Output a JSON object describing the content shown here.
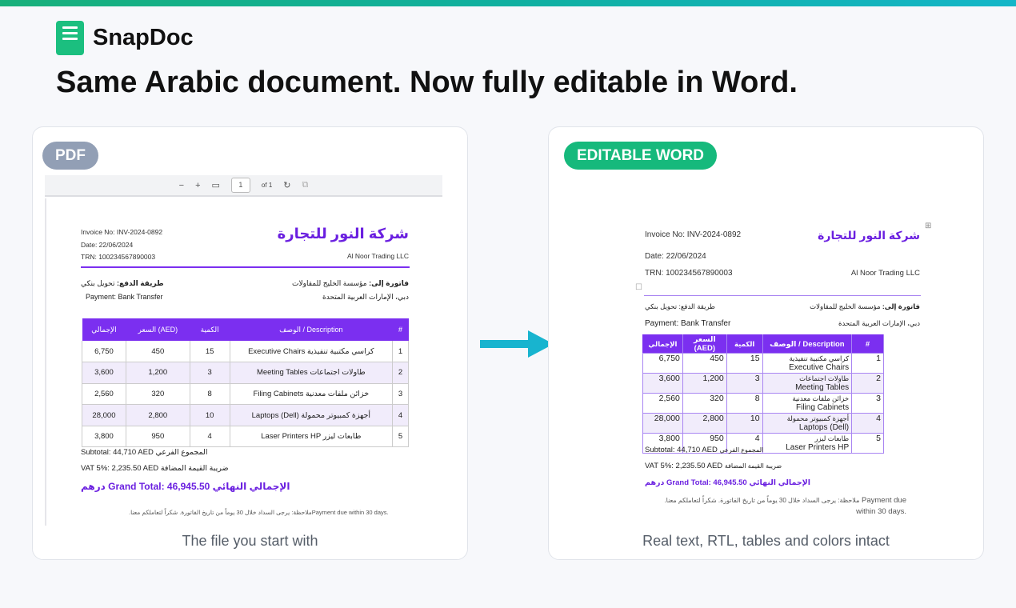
{
  "brand": {
    "name": "SnapDoc"
  },
  "headline": "Same Arabic document. Now fully editable in Word.",
  "left_card": {
    "badge": "PDF",
    "caption": "The file you start with",
    "toolbar": {
      "zoom_out": "−",
      "zoom_in": "+",
      "page_value": "1",
      "page_of": "of 1"
    }
  },
  "right_card": {
    "badge": "EDITABLE WORD",
    "caption": "Real text, RTL, tables and colors intact"
  },
  "colors": {
    "accent_green": "#16b97c",
    "accent_purple": "#7b2ff0",
    "pdf_badge": "#929fb5",
    "arrow": "#18b4cf"
  },
  "invoice": {
    "invoice_no": "Invoice No: INV-2024-0892",
    "date": "Date: 22/06/2024",
    "trn": "TRN: 100234567890003",
    "company_ar": "شركة النور للتجارة",
    "company_en": "Al Noor Trading LLC",
    "bill_to_label": "فاتورة إلى:",
    "bill_to_name": "مؤسسة الخليج للمقاولات",
    "bill_to_city": "دبي، الإمارات العربية المتحدة",
    "payment_label_ar": "طريقة الدفع:",
    "payment_value_ar": "تحويل بنكي",
    "payment_en": "Payment: Bank Transfer",
    "headers": {
      "num": "#",
      "desc": "الوصف / Description",
      "qty": "الكمية",
      "price": "السعر (AED)",
      "total": "الإجمالي"
    },
    "rows": [
      {
        "num": "1",
        "desc_ar": "كراسي مكتبية تنفيذية",
        "desc_en": "Executive Chairs",
        "qty": "15",
        "price": "450",
        "total": "6,750"
      },
      {
        "num": "2",
        "desc_ar": "طاولات اجتماعات",
        "desc_en": "Meeting Tables",
        "qty": "3",
        "price": "1,200",
        "total": "3,600"
      },
      {
        "num": "3",
        "desc_ar": "خزائن ملفات معدنية",
        "desc_en": "Filing Cabinets",
        "qty": "8",
        "price": "320",
        "total": "2,560"
      },
      {
        "num": "4",
        "desc_ar": "أجهزة كمبيوتر محمولة",
        "desc_en": "Laptops (Dell)",
        "qty": "10",
        "price": "2,800",
        "total": "28,000"
      },
      {
        "num": "5",
        "desc_ar": "طابعات ليزر",
        "desc_en": "Laser Printers HP",
        "qty": "4",
        "price": "950",
        "total": "3,800"
      }
    ],
    "subtotal_en": "Subtotal: 44,710 AED",
    "subtotal_ar": "المجموع الفرعي",
    "vat_en": "VAT 5%: 2,235.50 AED",
    "vat_ar": "ضريبة القيمة المضافة",
    "grand_ar": "الإجمالي النهائي",
    "grand_en": "Grand Total: 46,945.50",
    "grand_currency_ar": "درهم",
    "note_ar": "ملاحظة: يرجى السداد خلال 30 يوماً من تاريخ الفاتورة. شكراً لتعاملكم معنا.",
    "note_en": "Payment due within 30 days."
  }
}
